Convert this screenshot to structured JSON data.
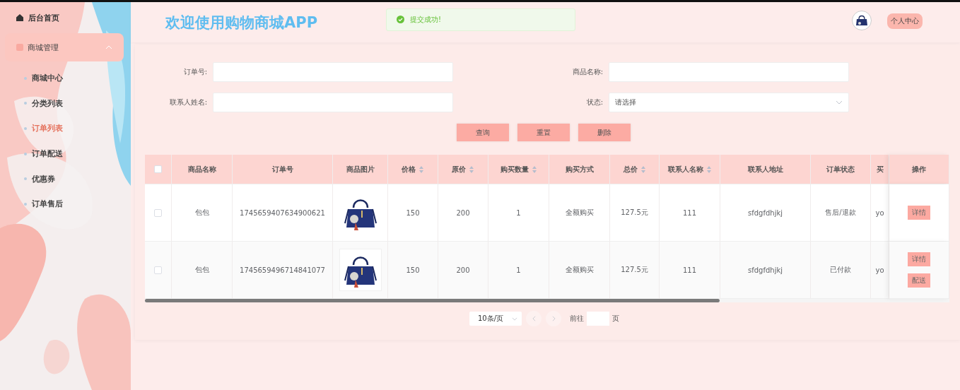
{
  "sidebar": {
    "home": "后台首页",
    "groups": [
      {
        "label": "商城管理",
        "expanded": true,
        "children": [
          {
            "label": "商城中心",
            "selected": false
          },
          {
            "label": "分类列表",
            "selected": false
          },
          {
            "label": "订单列表",
            "selected": true
          },
          {
            "label": "订单配送",
            "selected": false
          },
          {
            "label": "优惠券",
            "selected": false
          },
          {
            "label": "订单售后",
            "selected": false
          }
        ]
      }
    ]
  },
  "header": {
    "title": "欢迎使用购物商城APP",
    "user_button": "个人中心"
  },
  "toast": {
    "message": "提交成功!"
  },
  "search": {
    "fields": [
      {
        "label": "订单号:",
        "kind": "input"
      },
      {
        "label": "商品名称:",
        "kind": "input"
      },
      {
        "label": "联系人姓名:",
        "kind": "input"
      },
      {
        "label": "状态:",
        "kind": "select",
        "placeholder": "请选择"
      }
    ],
    "buttons": [
      "查询",
      "重置",
      "删除"
    ]
  },
  "table": {
    "all_checked": false,
    "columns": [
      {
        "label": "商品名称",
        "sortable": false
      },
      {
        "label": "订单号",
        "sortable": false
      },
      {
        "label": "商品图片",
        "sortable": false
      },
      {
        "label": "价格",
        "sortable": true
      },
      {
        "label": "原价",
        "sortable": true
      },
      {
        "label": "购买数量",
        "sortable": true
      },
      {
        "label": "购买方式",
        "sortable": false
      },
      {
        "label": "总价",
        "sortable": true
      },
      {
        "label": "联系人名称",
        "sortable": true
      },
      {
        "label": "联系人地址",
        "sortable": false
      },
      {
        "label": "订单状态",
        "sortable": false
      },
      {
        "label": "买",
        "sortable": false
      }
    ],
    "actions_heading": "操作",
    "rows": [
      {
        "checked": false,
        "cells": [
          "包包",
          "1745659407634900621",
          {
            "kind": "picture"
          },
          "150",
          "200",
          "1",
          "全额购买",
          "127.5元",
          "111",
          "sfdgfdhjkj",
          "售后/退款",
          "yo"
        ],
        "actions": [
          "详情"
        ]
      },
      {
        "checked": false,
        "cells": [
          "包包",
          "1745659496714841077",
          {
            "kind": "picture"
          },
          "150",
          "200",
          "1",
          "全额购买",
          "127.5元",
          "111",
          "sfdgfdhjkj",
          "已付款",
          "yo"
        ],
        "actions": [
          "详情",
          "配送"
        ]
      }
    ]
  },
  "pagination": {
    "page_size": "10条/页",
    "goto_label": "前往",
    "page_unit": "页"
  }
}
